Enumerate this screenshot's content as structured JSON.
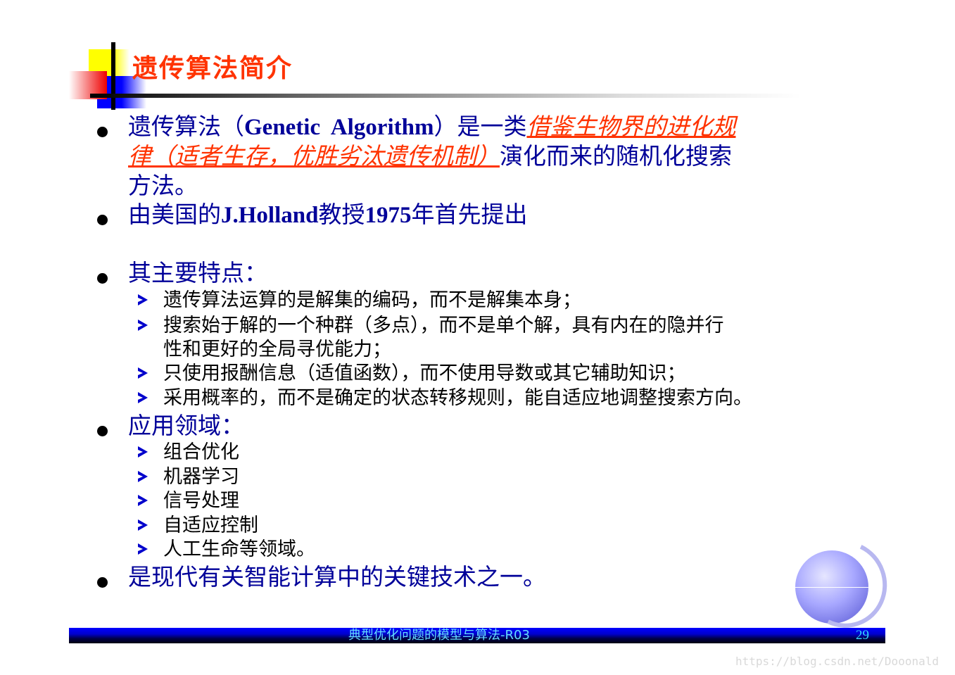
{
  "slide": {
    "title": "遗传算法简介",
    "bullets": [
      {
        "lines": [
          {
            "segments": [
              {
                "text": "遗传算法（",
                "style": "normal"
              },
              {
                "text": "Genetic  Algorithm",
                "style": "en"
              },
              {
                "text": "）是一类",
                "style": "normal"
              },
              {
                "text": "借鉴生物界的进化规",
                "style": "red"
              }
            ]
          },
          {
            "segments": [
              {
                "text": "律（适者生存，优胜劣汰遗传机制）",
                "style": "red"
              },
              {
                "text": "演化而来的随机化搜索",
                "style": "normal"
              }
            ]
          },
          {
            "segments": [
              {
                "text": "方法。",
                "style": "normal"
              }
            ]
          }
        ]
      },
      {
        "lines": [
          {
            "segments": [
              {
                "text": "由美国的",
                "style": "normal"
              },
              {
                "text": "J.Holland",
                "style": "en"
              },
              {
                "text": "教授",
                "style": "normal"
              },
              {
                "text": "1975",
                "style": "en"
              },
              {
                "text": "年首先提出",
                "style": "normal"
              }
            ]
          }
        ]
      },
      {
        "text": "其主要特点：",
        "subitems": [
          "遗传算法运算的是解集的编码，而不是解集本身；",
          "搜索始于解的一个种群（多点），而不是单个解，具有内在的隐并行",
          "性和更好的全局寻优能力；",
          "只使用报酬信息（适值函数），而不使用导数或其它辅助知识；",
          "采用概率的，而不是确定的状态转移规则，能自适应地调整搜索方向。"
        ]
      },
      {
        "text": "应用领域：",
        "subitems": [
          "组合优化",
          "机器学习",
          "信号处理",
          "自适应控制",
          "人工生命等领域。"
        ]
      },
      {
        "text": "是现代有关智能计算中的关键技术之一。"
      }
    ]
  },
  "footer": {
    "course_title": "典型优化问题的模型与算法-R03",
    "page_number": "29"
  },
  "watermark": "https://blog.csdn.net/Dooonald",
  "colors": {
    "title": "#ff3300",
    "bullet_text": "#000099",
    "highlight": "#ff3300",
    "subitem_text": "#000000",
    "footer_bar": "#0000ff",
    "footer_text": "#66ddff"
  }
}
